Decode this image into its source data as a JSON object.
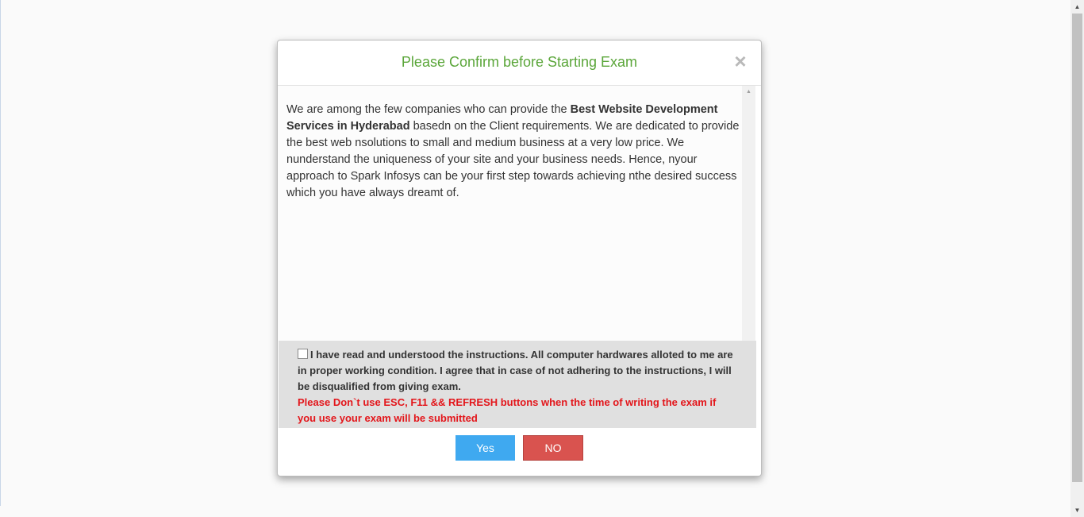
{
  "modal": {
    "title": "Please Confirm before Starting Exam",
    "close_icon": "×",
    "body": {
      "intro": "We are among the few companies who can provide the ",
      "bold": "Best Website Development Services in Hyderabad",
      "rest": " basedn on the Client requirements. We are dedicated to provide the best web nsolutions to small and medium business at a very low price. We nunderstand the uniqueness of your site and your business needs. Hence, nyour approach to Spark Infosys can be your first step towards achieving nthe desired success which you have always dreamt of."
    },
    "agreement": "I have read and understood the instructions. All computer hardwares alloted to me are in proper working condition. I agree that in case of not adhering to the instructions, I will be disqualified from giving exam.",
    "agreement_checked": false,
    "warning": "Please Don`t use ESC, F11 && REFRESH buttons when the time of writing the exam if you use your exam will be submitted",
    "buttons": {
      "yes_label": "Yes",
      "no_label": "NO"
    }
  },
  "colors": {
    "title": "#5ba63a",
    "warning": "#e3161b",
    "yes_button": "#3fa9f0",
    "no_button": "#d9534f"
  }
}
